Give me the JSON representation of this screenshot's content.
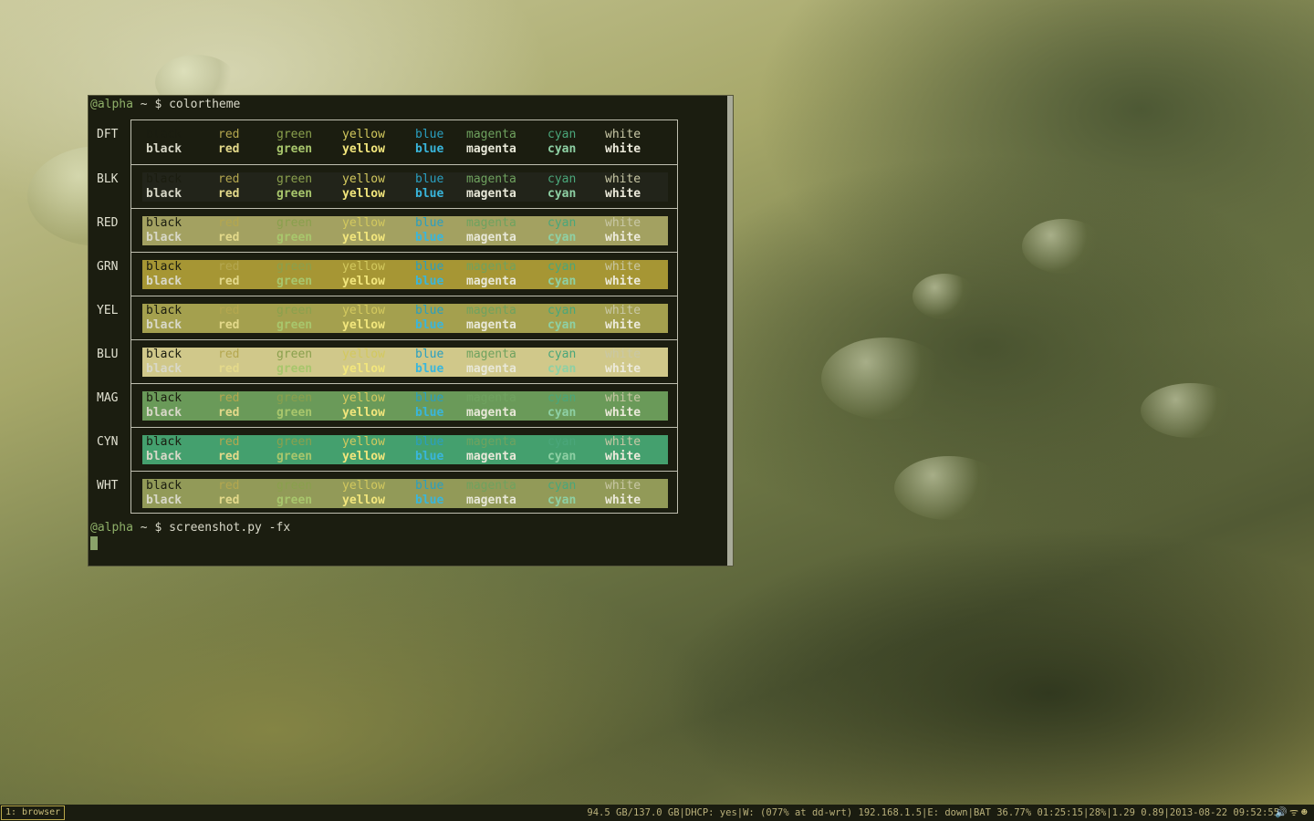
{
  "terminal": {
    "prompt_host": "@alpha",
    "prompt_path": " ~ $ ",
    "command1": "colortheme",
    "command2": "screenshot.py -fx"
  },
  "colortheme": {
    "names": [
      "black",
      "red",
      "green",
      "yellow",
      "blue",
      "magenta",
      "cyan",
      "white"
    ],
    "colors": {
      "black": "#1b1d10",
      "red": "#b4a74f",
      "green": "#8aa04d",
      "yellow": "#d3c95e",
      "blue": "#2a9fc0",
      "magenta": "#6fa25f",
      "cyan": "#4aa67a",
      "white": "#c9c8a6"
    },
    "bold_colors": {
      "black": "#d8d8c8",
      "red": "#e3d98a",
      "green": "#a8c66c",
      "yellow": "#f2e67c",
      "blue": "#39b6dc",
      "magenta": "#e8e8d8",
      "cyan": "#8ed0a4",
      "white": "#eceadb"
    },
    "rows": [
      {
        "label": "DFT",
        "bg": "#1b1d10"
      },
      {
        "label": "BLK",
        "bg": "#22241a"
      },
      {
        "label": "RED",
        "bg": "#a3a161"
      },
      {
        "label": "GRN",
        "bg": "#a69634"
      },
      {
        "label": "YEL",
        "bg": "#a4a04e"
      },
      {
        "label": "BLU",
        "bg": "#d0c88a"
      },
      {
        "label": "MAG",
        "bg": "#6a9a59"
      },
      {
        "label": "CYN",
        "bg": "#44a06e"
      },
      {
        "label": "WHT",
        "bg": "#929a58"
      }
    ]
  },
  "statusbar": {
    "workspace": "1: browser",
    "info": "94.5 GB/137.0 GB|DHCP: yes|W: (077% at dd-wrt) 192.168.1.5|E: down|BAT 36.77% 01:25:15|28%|1.29 0.89|2013-08-22 09:52:55",
    "icon_volume": "🔊",
    "icon_wifi": "ᯤ",
    "icon_face": "☻"
  }
}
